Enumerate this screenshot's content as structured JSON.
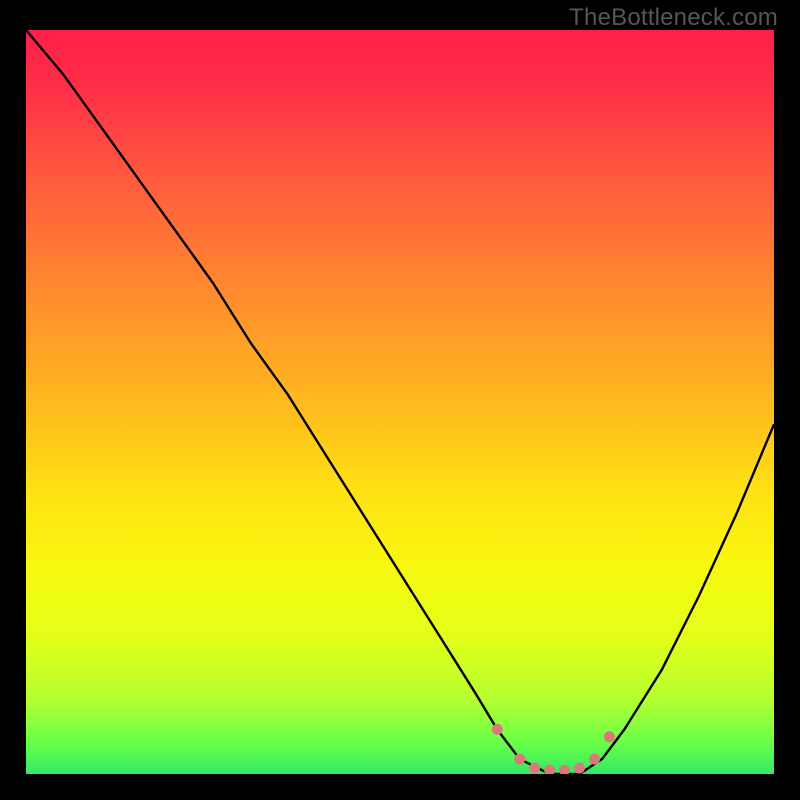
{
  "watermark": "TheBottleneck.com",
  "chart_data": {
    "type": "line",
    "title": "",
    "xlabel": "",
    "ylabel": "",
    "xlim": [
      0,
      100
    ],
    "ylim": [
      0,
      100
    ],
    "gradient_stops": [
      {
        "offset": 0.0,
        "color": "#ff1f4a"
      },
      {
        "offset": 0.08,
        "color": "#ff2f47"
      },
      {
        "offset": 0.2,
        "color": "#ff5a3d"
      },
      {
        "offset": 0.35,
        "color": "#ff8a2f"
      },
      {
        "offset": 0.5,
        "color": "#ffb91f"
      },
      {
        "offset": 0.62,
        "color": "#ffe114"
      },
      {
        "offset": 0.72,
        "color": "#f8f80e"
      },
      {
        "offset": 0.82,
        "color": "#e2ff1a"
      },
      {
        "offset": 0.9,
        "color": "#b4ff30"
      },
      {
        "offset": 0.96,
        "color": "#66ff4a"
      },
      {
        "offset": 1.0,
        "color": "#35e867"
      }
    ],
    "series": [
      {
        "name": "bottleneck-curve",
        "color": "#000000",
        "x": [
          0,
          5,
          10,
          15,
          20,
          25,
          30,
          35,
          40,
          45,
          50,
          55,
          60,
          63,
          66,
          70,
          74,
          77,
          80,
          85,
          90,
          95,
          100
        ],
        "y": [
          100,
          94,
          87,
          80,
          73,
          66,
          58,
          51,
          43,
          35,
          27,
          19,
          11,
          6,
          2,
          0,
          0,
          2,
          6,
          14,
          24,
          35,
          47
        ]
      }
    ],
    "markers": {
      "name": "optimal-range",
      "color": "#d87a7a",
      "points": [
        {
          "x": 63,
          "y": 6
        },
        {
          "x": 66,
          "y": 2
        },
        {
          "x": 68,
          "y": 0.8
        },
        {
          "x": 70,
          "y": 0.5
        },
        {
          "x": 72,
          "y": 0.5
        },
        {
          "x": 74,
          "y": 0.8
        },
        {
          "x": 76,
          "y": 2
        },
        {
          "x": 78,
          "y": 5
        }
      ]
    }
  }
}
